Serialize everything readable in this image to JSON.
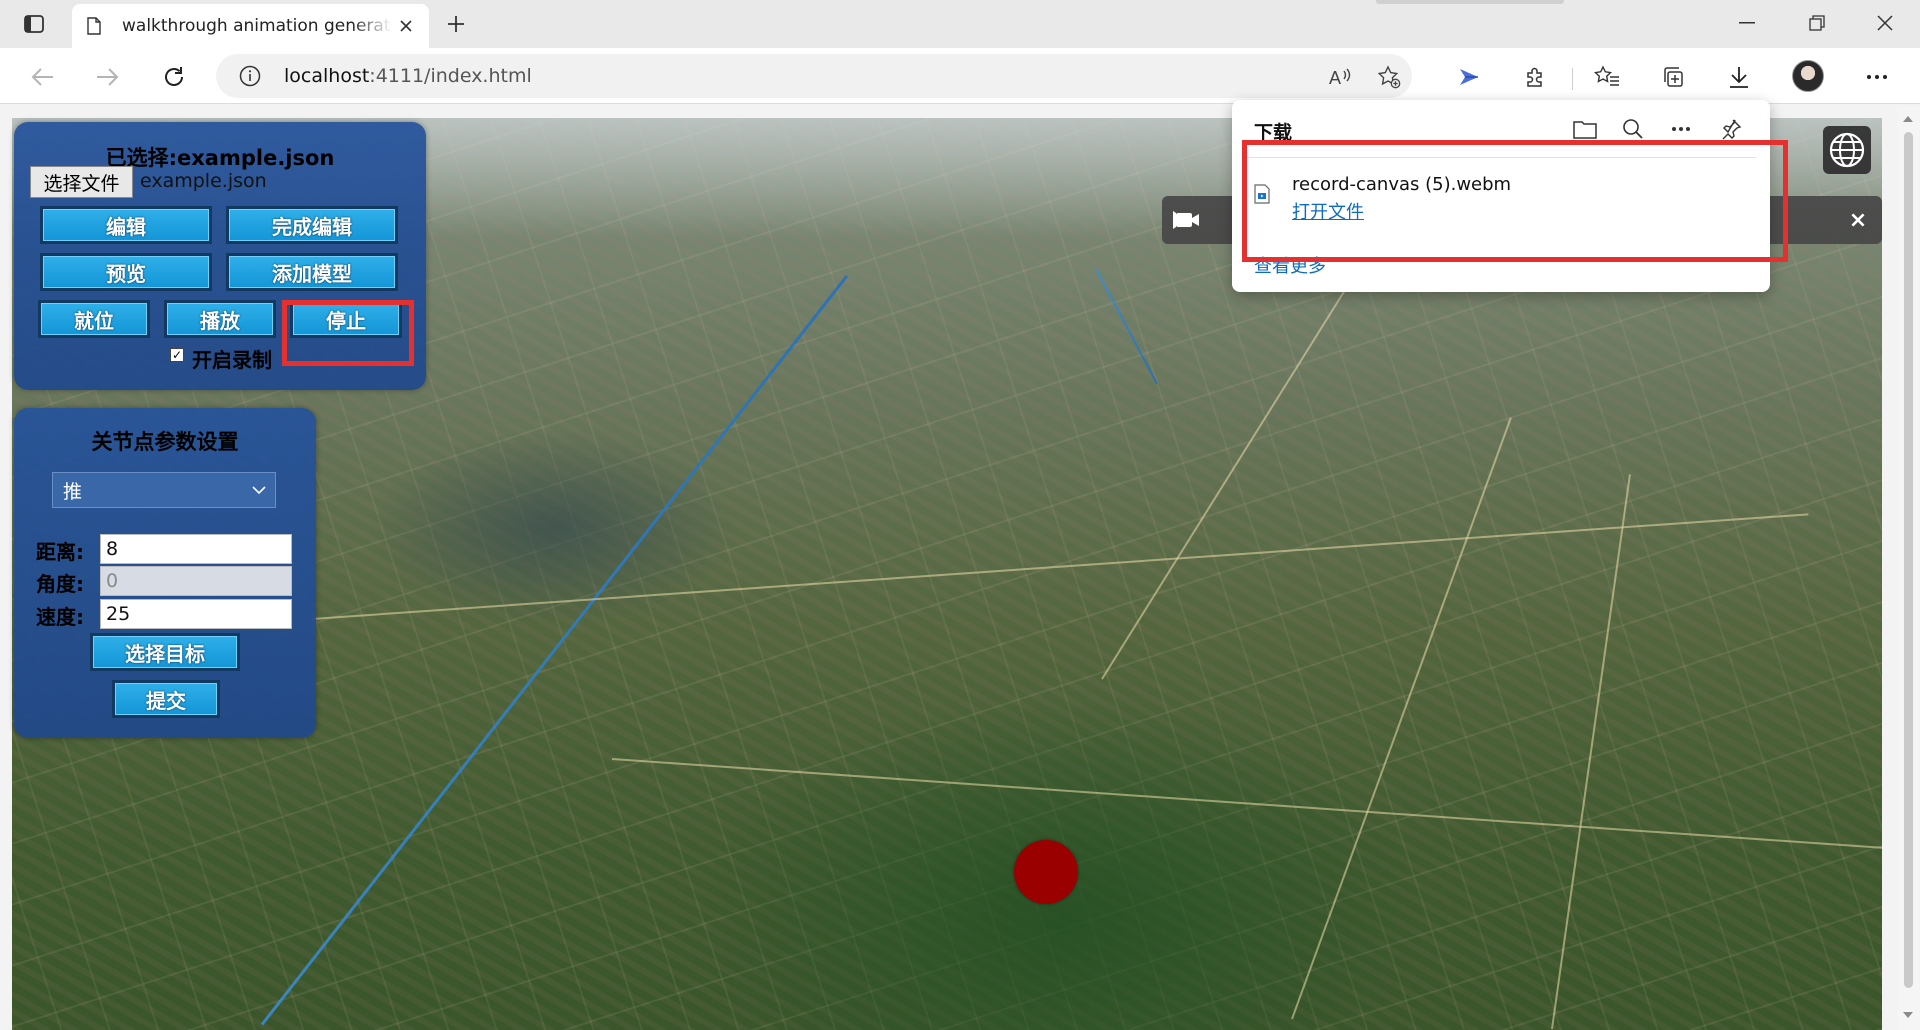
{
  "browser": {
    "tab_title": "walkthrough animation generator",
    "url_host": "localhost",
    "url_rest": ":4111/index.html",
    "icons": [
      "tab-actions-icon",
      "page-icon",
      "close-icon",
      "plus-icon",
      "minimize-icon",
      "restore-icon",
      "close-window-icon",
      "back-icon",
      "forward-icon",
      "refresh-icon",
      "info-icon",
      "read-aloud-icon",
      "favorite-add-icon",
      "extension-icon",
      "puzzle-icon",
      "favorites-icon",
      "collections-icon",
      "download-icon",
      "more-icon"
    ]
  },
  "panel1": {
    "title": "已选择:example.json",
    "file_button": "选择文件",
    "file_name": "example.json",
    "edit": "编辑",
    "finish_edit": "完成编辑",
    "preview": "预览",
    "add_model": "添加模型",
    "position": "就位",
    "play": "播放",
    "stop": "停止",
    "record_label": "开启录制",
    "record_checked": true
  },
  "panel2": {
    "title": "关节点参数设置",
    "mode_value": "推",
    "distance_label": "距离:",
    "distance_value": "8",
    "angle_label": "角度:",
    "angle_value": "0",
    "speed_label": "速度:",
    "speed_value": "25",
    "select_target": "选择目标",
    "submit": "提交"
  },
  "downloads": {
    "title": "下载",
    "file_name": "record-canvas (5).webm",
    "open_file": "打开文件",
    "see_more": "查看更多",
    "icons": [
      "folder-icon",
      "search-icon",
      "more-icon",
      "pin-icon",
      "video-file-icon"
    ]
  },
  "overlay": {
    "video_close": "×"
  },
  "colors": {
    "panel_bg": "#24529b",
    "button_bg": "#1a9fdf",
    "highlight": "#e53030",
    "marker": "#9b0000",
    "link": "#0f6cbd"
  }
}
